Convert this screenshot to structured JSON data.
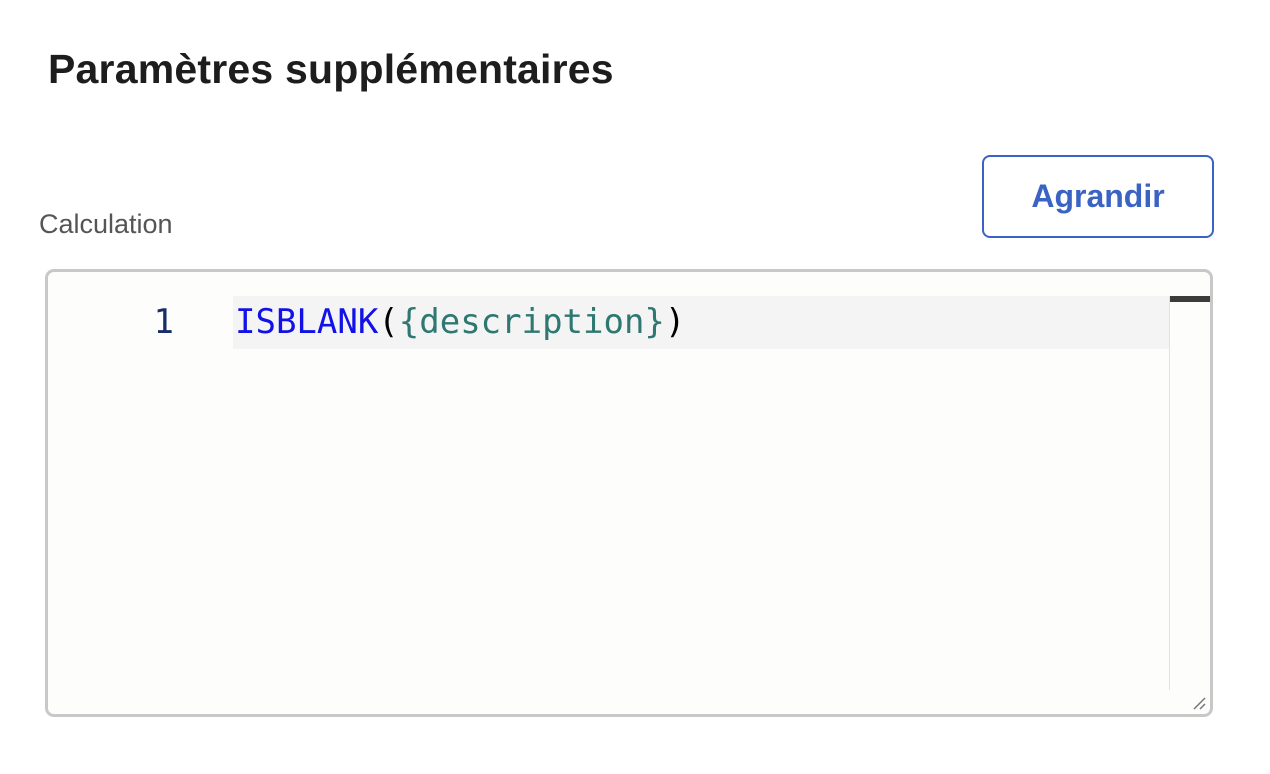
{
  "section": {
    "title": "Paramètres supplémentaires",
    "expand_button_label": "Agrandir"
  },
  "field": {
    "label": "Calculation"
  },
  "editor": {
    "lines": [
      {
        "number": "1",
        "tokens": {
          "function": "ISBLANK",
          "open_paren": "(",
          "field_ref": "{description}",
          "close_paren": ")"
        }
      }
    ],
    "colors": {
      "function": "#1111e8",
      "field_ref": "#2e7871",
      "line_number": "#1a2d6b"
    }
  },
  "colors": {
    "accent": "#3a63c4",
    "title": "#1d1d1d",
    "label": "#555555"
  }
}
